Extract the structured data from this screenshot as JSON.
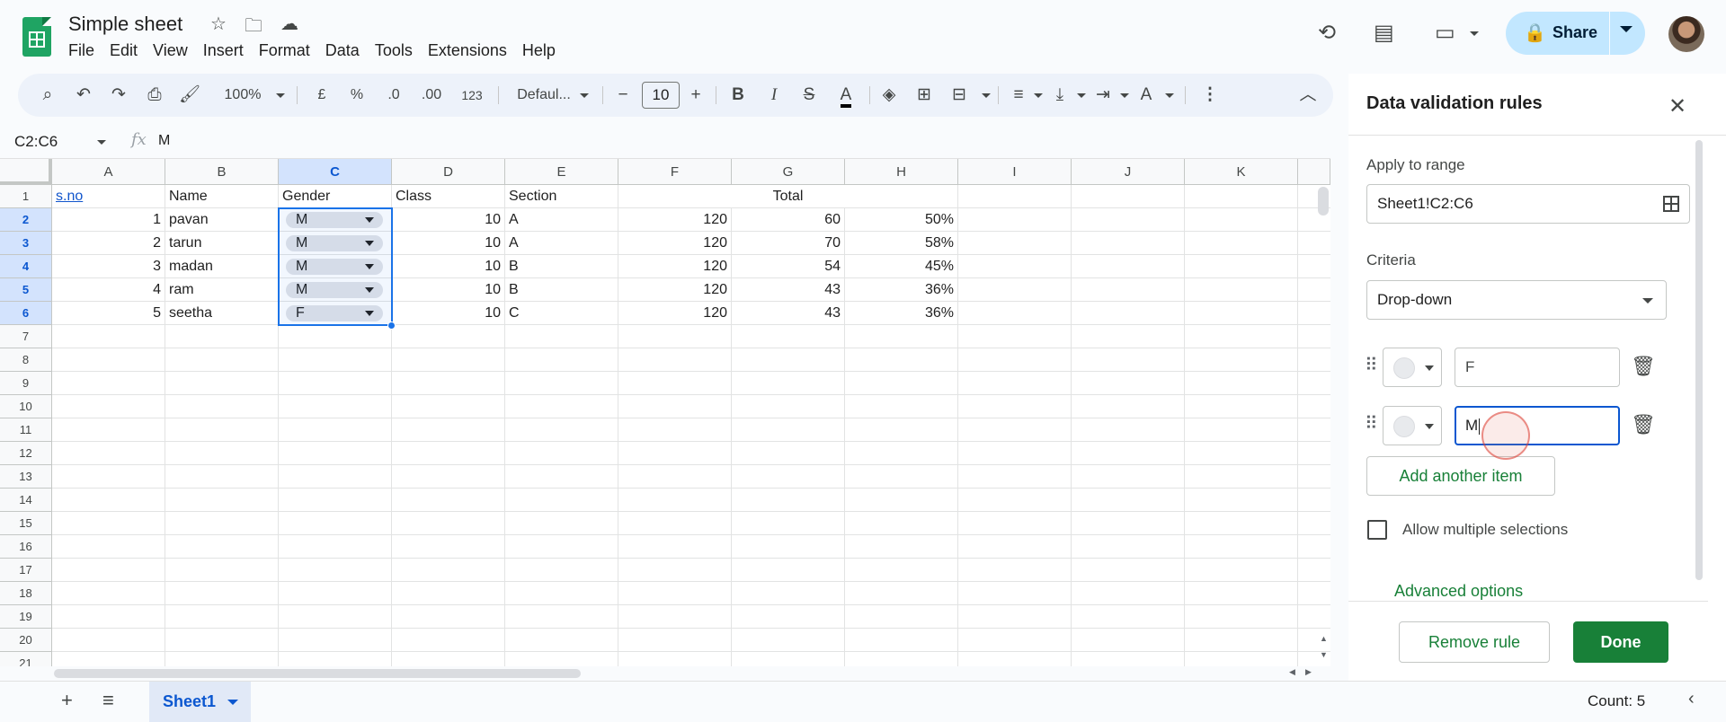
{
  "doc": {
    "title": "Simple sheet"
  },
  "menu": [
    "File",
    "Edit",
    "View",
    "Insert",
    "Format",
    "Data",
    "Tools",
    "Extensions",
    "Help"
  ],
  "share": {
    "label": "Share"
  },
  "toolbar": {
    "zoom": "100%",
    "currency": "£",
    "percent": "%",
    "decimal_dec": ".0",
    "decimal_inc": ".00",
    "format": "123",
    "font": "Defaul...",
    "font_size": "10"
  },
  "formula": {
    "name_box": "C2:C6",
    "value": "M"
  },
  "grid": {
    "columns": [
      "A",
      "B",
      "C",
      "D",
      "E",
      "F",
      "G",
      "H",
      "I",
      "J",
      "K"
    ],
    "rows": [
      "1",
      "2",
      "3",
      "4",
      "5",
      "6",
      "7",
      "8",
      "9",
      "10",
      "11",
      "12",
      "13",
      "14",
      "15",
      "16",
      "17",
      "18",
      "19",
      "20",
      "21"
    ],
    "header": {
      "a": "s.no",
      "b": "Name",
      "c": "Gender",
      "d": "Class",
      "e": "Section",
      "f": "Total"
    },
    "data": [
      {
        "a": "1",
        "b": "pavan",
        "c": "M",
        "d": "10",
        "e": "A",
        "f": "120",
        "g": "60",
        "h": "50%"
      },
      {
        "a": "2",
        "b": "tarun",
        "c": "M",
        "d": "10",
        "e": "A",
        "f": "120",
        "g": "70",
        "h": "58%"
      },
      {
        "a": "3",
        "b": "madan",
        "c": "M",
        "d": "10",
        "e": "B",
        "f": "120",
        "g": "54",
        "h": "45%"
      },
      {
        "a": "4",
        "b": "ram",
        "c": "M",
        "d": "10",
        "e": "B",
        "f": "120",
        "g": "43",
        "h": "36%"
      },
      {
        "a": "5",
        "b": "seetha",
        "c": "F",
        "d": "10",
        "e": "C",
        "f": "120",
        "g": "43",
        "h": "36%"
      }
    ]
  },
  "bottom": {
    "sheet_tab": "Sheet1",
    "count": "Count: 5"
  },
  "panel": {
    "title": "Data validation rules",
    "apply_label": "Apply to range",
    "range": "Sheet1!C2:C6",
    "criteria_label": "Criteria",
    "criteria": "Drop-down",
    "items": [
      "F",
      "M"
    ],
    "add_item": "Add another item",
    "allow_multiple": "Allow multiple selections",
    "advanced": "Advanced options",
    "remove": "Remove rule",
    "done": "Done"
  }
}
